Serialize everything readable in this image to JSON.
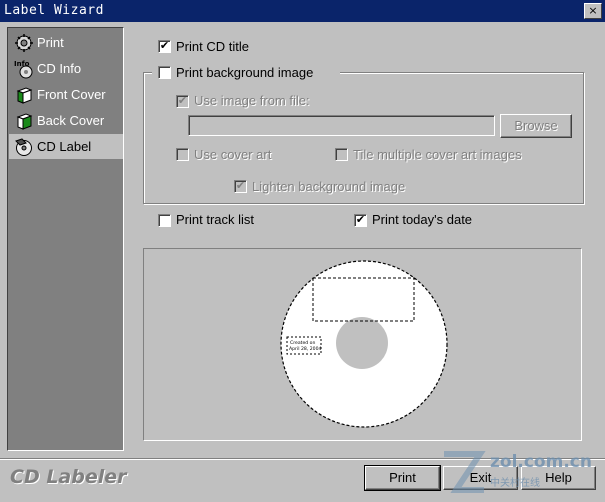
{
  "window": {
    "title": "Label Wizard",
    "close_glyph": "×"
  },
  "sidebar": {
    "items": [
      {
        "label": "Print",
        "icon": "gear-icon"
      },
      {
        "label": "CD Info",
        "icon": "info-icon"
      },
      {
        "label": "Front Cover",
        "icon": "front-cover-icon"
      },
      {
        "label": "Back Cover",
        "icon": "back-cover-icon"
      },
      {
        "label": "CD Label",
        "icon": "cd-label-icon",
        "active": true
      }
    ]
  },
  "options": {
    "print_cd_title": {
      "label": "Print CD title",
      "checked": true
    },
    "print_background_image": {
      "label": "Print background image",
      "checked": false
    },
    "use_image_from_file": {
      "label": "Use image from file:",
      "checked": true,
      "disabled": true
    },
    "image_path": {
      "value": ""
    },
    "browse_label": "Browse",
    "use_cover_art": {
      "label": "Use cover art",
      "checked": false,
      "disabled": true
    },
    "tile_cover_art": {
      "label": "Tile multiple cover art images",
      "checked": false,
      "disabled": true
    },
    "lighten_background": {
      "label": "Lighten background image",
      "checked": true,
      "disabled": true
    },
    "print_track_list": {
      "label": "Print track list",
      "checked": false
    },
    "print_todays_date": {
      "label": "Print today's date",
      "checked": true
    }
  },
  "preview": {
    "date_line1": "Created on",
    "date_line2": "April 28, 2004"
  },
  "footer": {
    "brand": "CD Labeler",
    "print_label": "Print",
    "exit_label": "Exit",
    "help_label": "Help"
  },
  "watermark": {
    "text": "zol.com.cn",
    "sub": "中关村在线"
  },
  "check_glyph": "✔"
}
